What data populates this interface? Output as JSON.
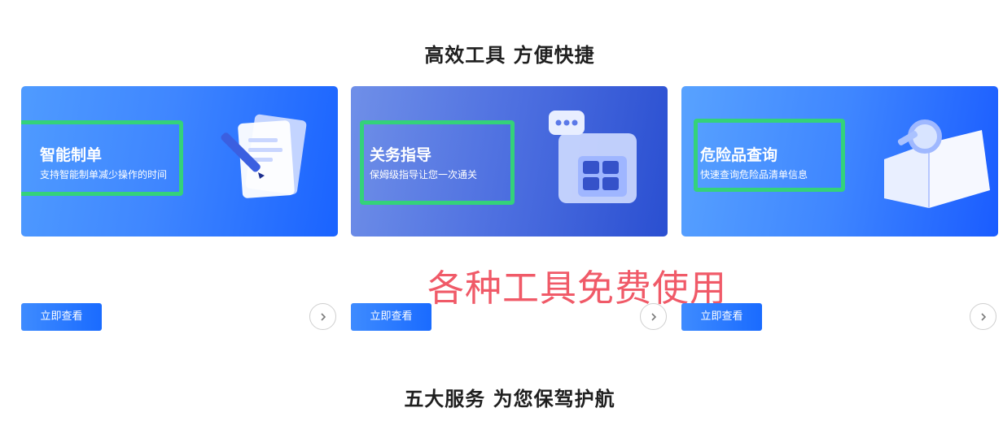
{
  "sections": {
    "top_title": "高效工具 方便快捷",
    "bottom_title": "五大服务 为您保驾护航"
  },
  "cards": [
    {
      "title": "智能制单",
      "desc": "支持智能制单减少操作的时间",
      "button": "立即查看",
      "icon": "document-pen-icon"
    },
    {
      "title": "关务指导",
      "desc": "保姆级指导让您一次通关",
      "button": "立即查看",
      "icon": "chat-window-icon"
    },
    {
      "title": "危险品查询",
      "desc": "快速查询危险品清单信息",
      "button": "立即查看",
      "icon": "book-magnifier-icon"
    }
  ],
  "annotation": "各种工具免费使用",
  "colors": {
    "highlight": "#34d27a",
    "annotation": "#f05a68",
    "button": "#2a78ff"
  }
}
